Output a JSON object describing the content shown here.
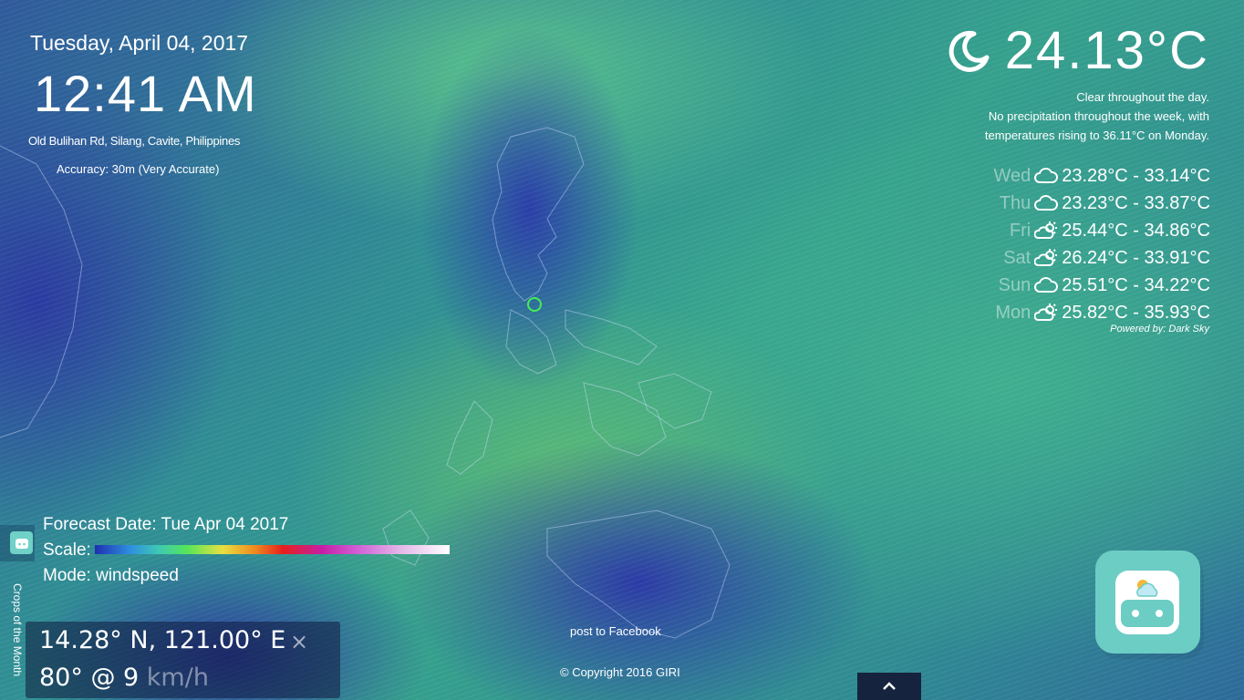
{
  "datetime": {
    "date": "Tuesday, April 04, 2017",
    "time": "12:41 AM",
    "address": "Old Bulihan Rd, Silang, Cavite, Philippines",
    "accuracy": "Accuracy: 30m (Very Accurate)"
  },
  "weather": {
    "current_icon": "crescent-moon-icon",
    "current_temp": "24.13°C",
    "summary_line1": "Clear throughout the day.",
    "summary_line2": "No precipitation throughout the week, with",
    "summary_line3": "temperatures rising to 36.11°C on Monday.",
    "forecast": [
      {
        "day": "Wed",
        "icon": "cloudy-icon",
        "range": "23.28°C - 33.14°C"
      },
      {
        "day": "Thu",
        "icon": "cloudy-icon",
        "range": "23.23°C - 33.87°C"
      },
      {
        "day": "Fri",
        "icon": "partly-cloudy-day-icon",
        "range": "25.44°C - 34.86°C"
      },
      {
        "day": "Sat",
        "icon": "partly-cloudy-day-icon",
        "range": "26.24°C - 33.91°C"
      },
      {
        "day": "Sun",
        "icon": "cloudy-icon",
        "range": "25.51°C - 34.22°C"
      },
      {
        "day": "Mon",
        "icon": "partly-cloudy-day-icon",
        "range": "25.82°C - 35.93°C"
      }
    ],
    "powered_by": "Powered by: Dark Sky"
  },
  "map_info": {
    "forecast_date": "Forecast Date: Tue Apr 04 2017",
    "scale_label": "Scale:",
    "mode": "Mode: windspeed"
  },
  "side_tab": {
    "label": "Crops of the Month"
  },
  "coords": {
    "position": "14.28° N, 121.00° E",
    "close": "×",
    "wind_value": "80° @ 9",
    "wind_unit": "km/h"
  },
  "footer": {
    "post_link": "post to Facebook",
    "copyright": "© Copyright 2016 GIRI",
    "up_icon": "chevron-up-icon"
  },
  "colors": {
    "marker": "#44ee55",
    "badge": "#6ccdc4"
  }
}
